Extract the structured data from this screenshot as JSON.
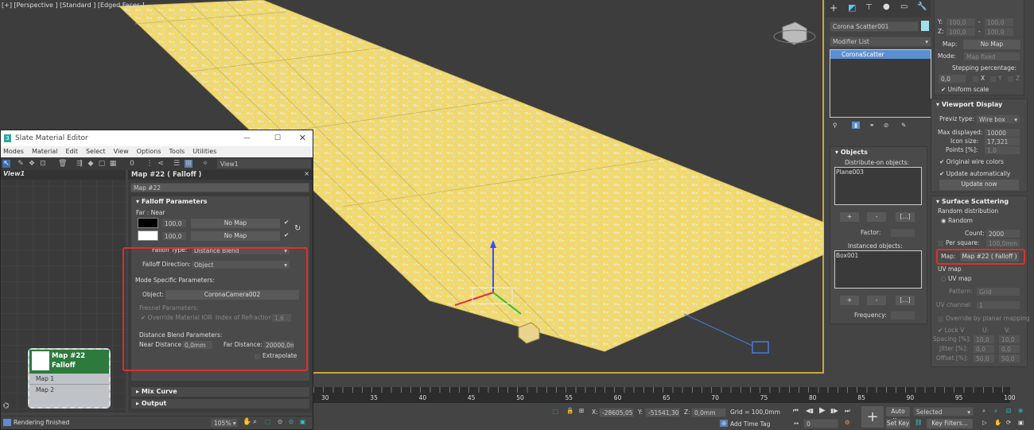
{
  "viewport": {
    "label": "[+] [Perspective ] [Standard ] [Edged Faces ]"
  },
  "slate": {
    "title": "Slate Material Editor",
    "menu": [
      "Modes",
      "Material",
      "Edit",
      "Select",
      "View",
      "Options",
      "Tools",
      "Utilities"
    ],
    "view_tab": "View1",
    "view_dropdown": "View1",
    "node": {
      "title1": "Map #22",
      "title2": "Falloff",
      "inputs": [
        "Map 1",
        "Map 2"
      ]
    },
    "params_title": "Map #22  ( Falloff )",
    "map_name": "Map #22",
    "falloff_rollout": "Falloff Parameters",
    "far_near": "Far : Near",
    "row1": {
      "value": "100,0",
      "map": "No Map",
      "color": "#000000"
    },
    "row2": {
      "value": "100,0",
      "map": "No Map",
      "color": "#ffffff"
    },
    "falloff_type_label": "Falloff Type:",
    "falloff_type": "Distance Blend",
    "falloff_dir_label": "Falloff Direction:",
    "falloff_dir": "Object",
    "mode_specific": "Mode Specific Parameters:",
    "object_label": "Object:",
    "object": "CoronaCamera002",
    "fresnel": "Fresnel Parameters:",
    "override_ior": "Override Material IOR",
    "ior_label": "Index of Refraction",
    "ior": "1,6",
    "dist_blend": "Distance Blend Parameters:",
    "near_label": "Near Distance:",
    "near": "0,0mm",
    "far_label": "Far Distance:",
    "far": "20000,0m",
    "extrapolate": "Extrapolate",
    "mix_curve": "Mix Curve",
    "output": "Output",
    "zoom": "105%"
  },
  "cmd": {
    "object_name": "Corona Scatter001",
    "object_color": "#9fe0ea",
    "modifier_list": "Modifier List",
    "stack": [
      "CoronaScatter"
    ],
    "objects": {
      "title": "Objects",
      "distribute_label": "Distribute-on objects:",
      "distribute": [
        "Plane003"
      ],
      "plus": "+",
      "minus": "-",
      "browse": "[...]",
      "factor": "Factor:",
      "instanced_label": "Instanced objects:",
      "instanced": [
        "Box001"
      ],
      "frequency": "Frequency:"
    },
    "scale": {
      "y": "Y:",
      "z": "Z:",
      "v": "100,0",
      "dash": "-",
      "map_label": "Map:",
      "map": "No Map",
      "mode_label": "Mode:",
      "mode": "Map fixed",
      "stepping": "Stepping percentage:",
      "step": "0,0",
      "x": "X",
      "yy": "Y",
      "zz": "Z",
      "uniform": "Uniform scale"
    },
    "vpd": {
      "title": "Viewport Display",
      "previz_label": "Previz type:",
      "previz": "Wire box",
      "max_label": "Max displayed:",
      "max": "10000",
      "icon_label": "Icon size:",
      "icon": "17,321",
      "points_label": "Points [%]:",
      "points": "1,0",
      "orig": "Original wire colors",
      "auto": "Update automatically",
      "update": "Update now"
    },
    "ss": {
      "title": "Surface Scattering",
      "random_dist": "Random distribution",
      "random": "Random",
      "count_label": "Count:",
      "count": "2000",
      "per_sq": "Per square:",
      "per_sq_v": "100,0mm",
      "map_label": "Map:",
      "map": "Map #22  ( Falloff )",
      "uvmap_group": "UV map",
      "uvmap": "UV map",
      "pattern_label": "Pattern:",
      "pattern": "Grid",
      "uvch_label": "UV channel:",
      "uvch": "1",
      "override": "Override by planar mapping",
      "lockv": "Lock V",
      "u": "U:",
      "v": "V:",
      "spacing": "Spacing [%]:",
      "spacing_u": "10,0",
      "spacing_v": "10,0",
      "jitter": "Jitter [%]:",
      "jitter_u": "0,0",
      "jitter_v": "0,0",
      "offset": "Offset [%]:",
      "offset_u": "50,0",
      "offset_v": "50,0"
    }
  },
  "timeline": {
    "ticks": [
      "30",
      "35",
      "40",
      "45",
      "50",
      "55",
      "60",
      "65",
      "70",
      "75",
      "80",
      "85",
      "90",
      "95",
      "100"
    ]
  },
  "status": {
    "message": "Rendering finished",
    "x_label": "X:",
    "x": "-28605,05",
    "y_label": "Y:",
    "y": "-51541,30",
    "z_label": "Z:",
    "z": "0,0mm",
    "grid": "Grid = 100,0mm",
    "add_time_tag": "Add Time Tag",
    "frame": "0",
    "auto_key": "Auto Key",
    "set_key": "Set Key",
    "selected": "Selected",
    "key_filters": "Key Filters..."
  }
}
